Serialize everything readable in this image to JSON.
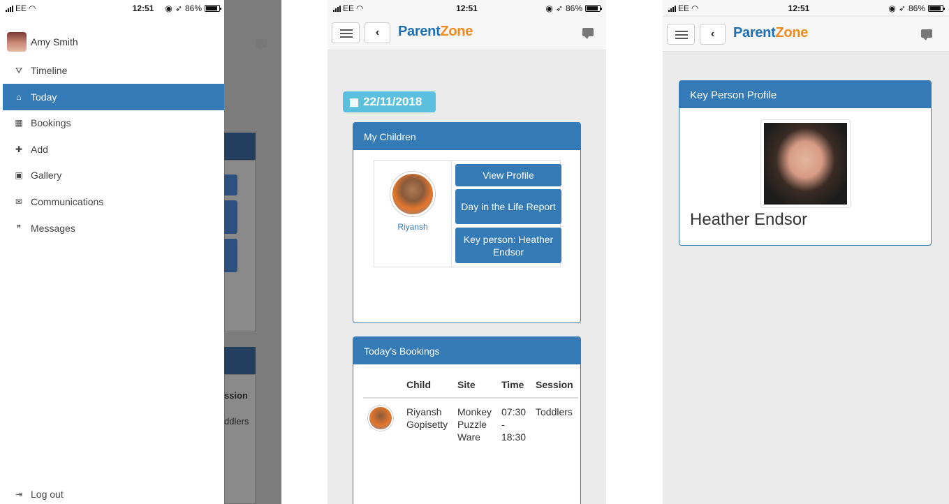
{
  "status_bar": {
    "carrier": "EE",
    "time": "12:51",
    "battery": "86%"
  },
  "screen1": {
    "user_name": "Amy Smith",
    "menu": [
      {
        "icon": "road-icon",
        "glyph": "⛛",
        "label": "Timeline"
      },
      {
        "icon": "home-icon",
        "glyph": "⌂",
        "label": "Today"
      },
      {
        "icon": "calendar-icon",
        "glyph": "▦",
        "label": "Bookings"
      },
      {
        "icon": "plus-icon",
        "glyph": "✚",
        "label": "Add"
      },
      {
        "icon": "picture-icon",
        "glyph": "▣",
        "label": "Gallery"
      },
      {
        "icon": "envelope-icon",
        "glyph": "✉",
        "label": "Communications"
      },
      {
        "icon": "comments-icon",
        "glyph": "❞",
        "label": "Messages"
      }
    ],
    "active_item": "Today",
    "logout_label": "Log out",
    "overlay_text": {
      "session": "ssion",
      "toddlers": "ddlers"
    }
  },
  "app": {
    "logo_part1": "Parent",
    "logo_part2": "Zone",
    "back_glyph": "‹"
  },
  "screen2": {
    "date": "22/11/2018",
    "my_children": {
      "title": "My Children",
      "child_name": "Riyansh",
      "buttons": [
        "View Profile",
        "Day in the Life Report",
        "Key person: Heather Endsor"
      ]
    },
    "bookings": {
      "title": "Today's Bookings",
      "columns": [
        "Child",
        "Site",
        "Time",
        "Session"
      ],
      "rows": [
        {
          "child": "Riyansh Gopisetty",
          "site": "Monkey Puzzle Ware",
          "time": "07:30 - 18:30",
          "session": "Toddlers"
        }
      ]
    }
  },
  "screen3": {
    "panel_title": "Key Person Profile",
    "name": "Heather Endsor"
  },
  "colors": {
    "primary": "#337ab7",
    "info": "#5bc0de",
    "logo_blue": "#1f6fb5",
    "logo_orange": "#f08a1c"
  }
}
